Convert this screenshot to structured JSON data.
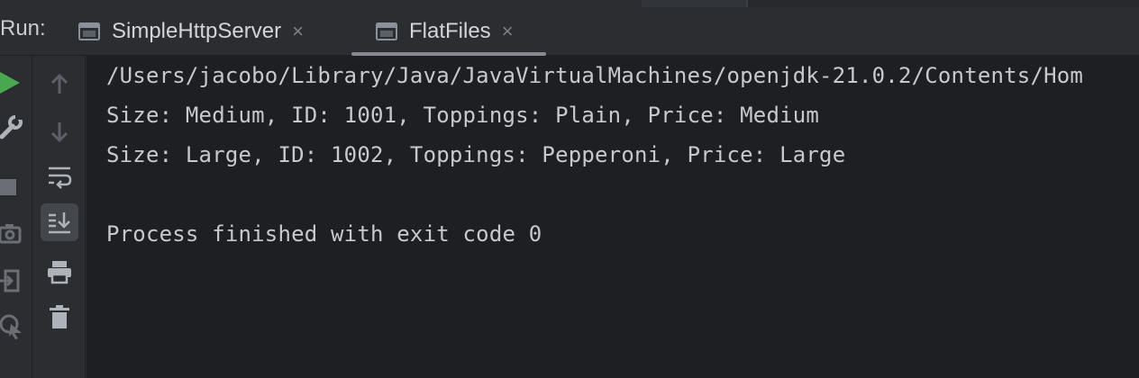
{
  "run_panel": {
    "label": "Run:",
    "tabs": [
      {
        "label": "SimpleHttpServer",
        "icon": "console-window-icon",
        "close": "×",
        "active": false
      },
      {
        "label": "FlatFiles",
        "icon": "console-window-icon",
        "close": "×",
        "active": true
      }
    ]
  },
  "left_toolbar": {
    "icons": [
      "run-icon",
      "wrench-icon",
      "stop-icon",
      "camera-icon",
      "exit-icon",
      "debug-icon"
    ],
    "run_color": "#49a84f"
  },
  "console_toolbar": {
    "icons": [
      "arrow-up-icon",
      "arrow-down-icon",
      "soft-wrap-icon",
      "scroll-to-end-icon",
      "print-icon",
      "trash-icon"
    ],
    "selected": "scroll-to-end-icon"
  },
  "console": {
    "lines": [
      "/Users/jacobo/Library/Java/JavaVirtualMachines/openjdk-21.0.2/Contents/Hom",
      "Size: Medium, ID: 1001, Toppings: Plain, Price: Medium",
      "Size: Large, ID: 1002, Toppings: Pepperoni, Price: Large",
      "",
      "Process finished with exit code 0"
    ]
  }
}
